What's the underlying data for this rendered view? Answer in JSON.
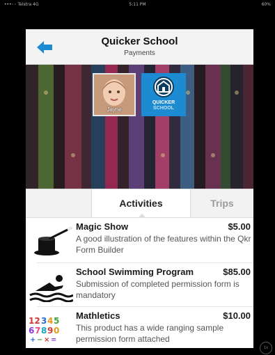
{
  "status_bar": {
    "carrier": "•••◦◦ Telstra 4G",
    "time": "5:11 PM",
    "battery": "60%"
  },
  "nav": {
    "title": "Quicker School",
    "subtitle": "Payments",
    "back_icon": "back-arrow-icon"
  },
  "banner": {
    "student_name": "Jayne",
    "logo_line1": "QUICKER",
    "logo_line2": "SCHOOL"
  },
  "tabs": [
    {
      "label": "Activities",
      "selected": true
    },
    {
      "label": "Trips",
      "selected": false
    }
  ],
  "items": [
    {
      "title": "Magic Show",
      "price": "$5.00",
      "description": "A good illustration of the features within the Qkr Form Builder",
      "icon": "magic-hat-icon"
    },
    {
      "title": "School Swimming Program",
      "price": "$85.00",
      "description": "Submission of completed permission form is mandatory",
      "icon": "swimmer-icon"
    },
    {
      "title": "Mathletics",
      "price": "$10.00",
      "description": "This product has a wide ranging sample permission form attached",
      "icon": "numbers-icon"
    }
  ],
  "zoom_label": "1x",
  "colors": {
    "accent": "#1c8bd1",
    "nav_bg": "#f3f3f3"
  }
}
